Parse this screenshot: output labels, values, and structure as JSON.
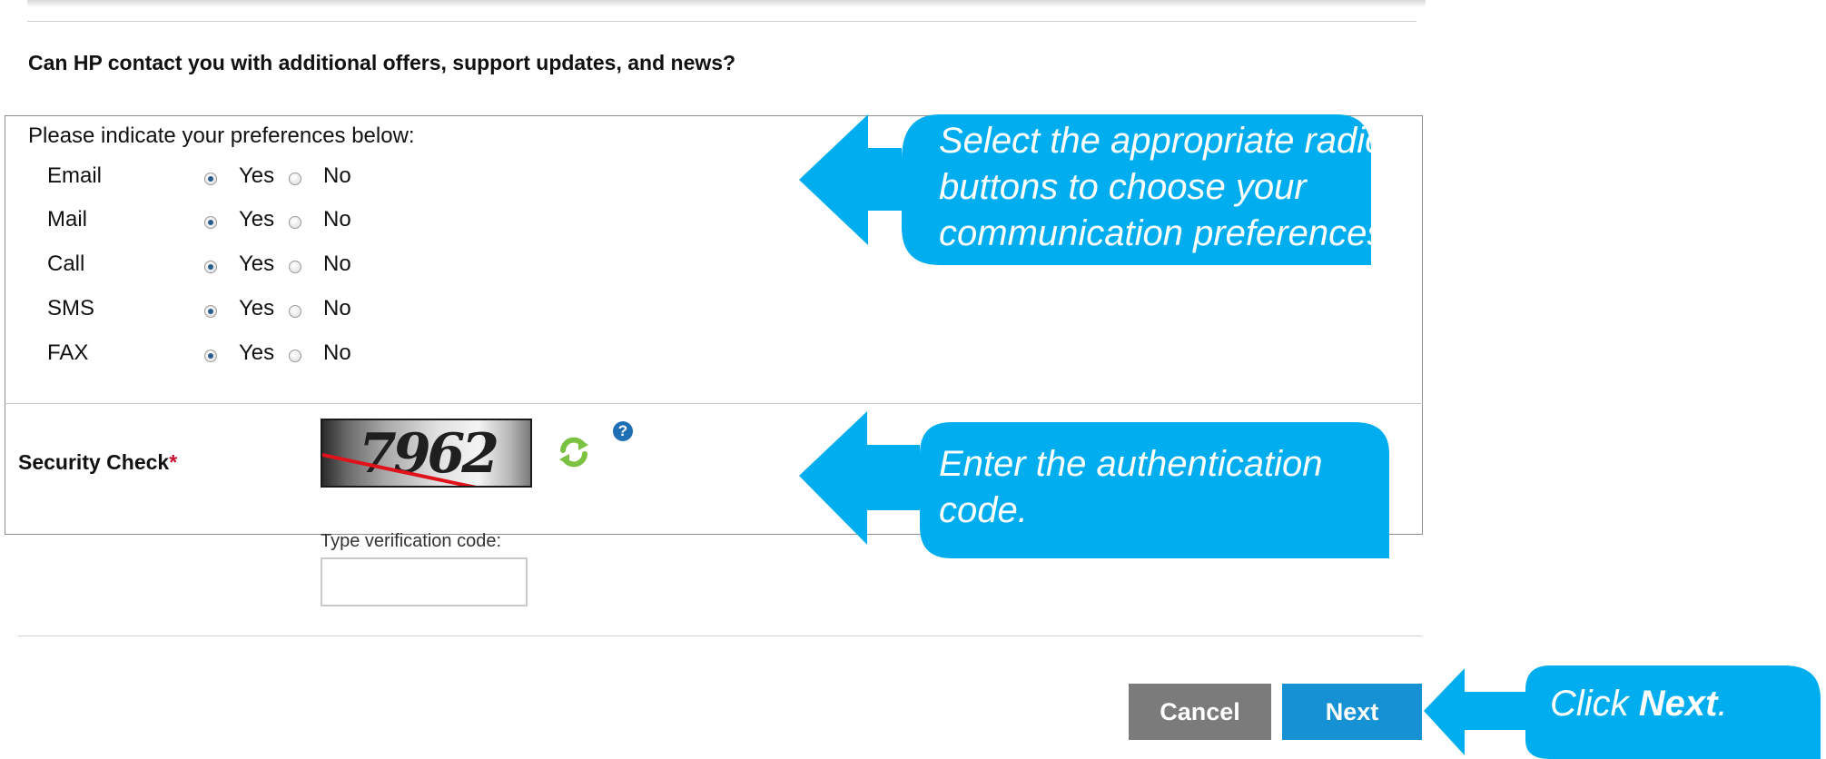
{
  "form": {
    "question": "Can HP contact you with additional offers, support updates, and news?",
    "preferences_intro": "Please indicate your preferences below:",
    "yes_label": "Yes",
    "no_label": "No",
    "channels": [
      {
        "label": "Email",
        "selected": "Yes"
      },
      {
        "label": "Mail",
        "selected": "Yes"
      },
      {
        "label": "Call",
        "selected": "Yes"
      },
      {
        "label": "SMS",
        "selected": "Yes"
      },
      {
        "label": "FAX",
        "selected": "Yes"
      }
    ],
    "security_label": "Security Check",
    "required_mark": "*",
    "captcha_text": "7962",
    "help_glyph": "?",
    "verify_label": "Type verification code:",
    "verify_value": ""
  },
  "buttons": {
    "cancel": "Cancel",
    "next": "Next"
  },
  "callouts": {
    "radio_hint": "Select the appropriate radio buttons to choose your communication preferences.",
    "code_hint": "Enter the authentication code.",
    "next_prefix": "Click ",
    "next_emphasis": "Next",
    "next_suffix": "."
  },
  "colors": {
    "callout": "#00aeef",
    "next_button": "#1591d4",
    "cancel_button": "#7b7b7b",
    "required": "#c8102e",
    "refresh_icon": "#7cc242"
  },
  "icons": {
    "refresh": "refresh-arrows-icon",
    "help": "question-mark-icon"
  }
}
